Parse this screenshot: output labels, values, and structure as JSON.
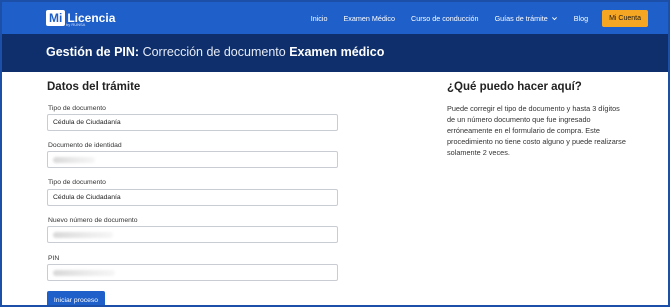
{
  "nav": {
    "logo_mi": "Mi",
    "logo_licencia": "Licencia",
    "logo_sub": "by RUNSA",
    "items": [
      "Inicio",
      "Examen Médico",
      "Curso de conducción",
      "Guías de trámite",
      "Blog"
    ],
    "account_button": "Mi Cuenta",
    "colors": {
      "nav_bg": "#1f5fc9",
      "banner_bg": "#0e2f6b",
      "account_bg": "#f5a623"
    }
  },
  "banner": {
    "title_bold": "Gestión de PIN:",
    "title_middle": "Corrección de documento",
    "title_end": "Examen médico"
  },
  "form": {
    "title": "Datos del trámite",
    "fields": [
      {
        "label": "Tipo de documento",
        "value": "Cédula de Ciudadanía"
      },
      {
        "label": "Documento de identidad",
        "value": ""
      },
      {
        "label": "Tipo de documento",
        "value": "Cédula de Ciudadanía"
      },
      {
        "label": "Nuevo número de documento",
        "value": ""
      },
      {
        "label": "PIN",
        "value": ""
      }
    ],
    "submit": "Iniciar proceso"
  },
  "help": {
    "title": "¿Qué puedo hacer aquí?",
    "text": "Puede corregir el tipo de documento y hasta 3 dígitos de un número documento que fue ingresado erróneamente en el formulario de compra. Este procedimiento no tiene costo alguno y puede realizarse solamente 2 veces."
  }
}
